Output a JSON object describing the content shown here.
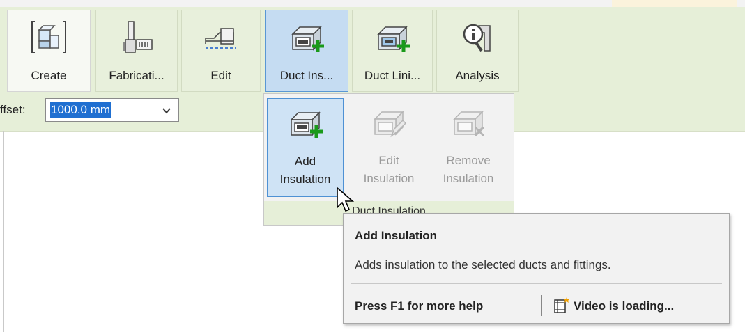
{
  "ribbon": {
    "buttons": [
      {
        "id": "create",
        "label": "Create",
        "icon": "create-icon"
      },
      {
        "id": "fabrication",
        "label": "Fabricati...",
        "icon": "fabrication-icon"
      },
      {
        "id": "edit",
        "label": "Edit",
        "icon": "edit-icon"
      },
      {
        "id": "duct_insulation",
        "label": "Duct Ins...",
        "icon": "duct-insulation-icon"
      },
      {
        "id": "duct_lining",
        "label": "Duct Lini...",
        "icon": "duct-lining-icon"
      },
      {
        "id": "analysis",
        "label": "Analysis",
        "icon": "analysis-icon"
      }
    ]
  },
  "options_bar": {
    "offset_label": "ffset:",
    "offset_value": "1000.0 mm"
  },
  "dropdown": {
    "items": [
      {
        "line1": "Add",
        "line2": "Insulation",
        "state": "hover",
        "icon": "add-insulation-icon"
      },
      {
        "line1": "Edit",
        "line2": "Insulation",
        "state": "disabled",
        "icon": "edit-insulation-icon"
      },
      {
        "line1": "Remove",
        "line2": "Insulation",
        "state": "disabled",
        "icon": "remove-insulation-icon"
      }
    ],
    "panel_title": "Duct Insulation"
  },
  "tooltip": {
    "title": "Add Insulation",
    "description": "Adds insulation to the selected ducts and fittings.",
    "help": "Press F1 for more help",
    "video": "Video is loading..."
  },
  "colors": {
    "ribbon_bg": "#e6efd8",
    "active_bg": "#c5dcf2",
    "active_border": "#5a97d4",
    "selection": "#1f6fd1",
    "plus_green": "#1a9a1a"
  }
}
